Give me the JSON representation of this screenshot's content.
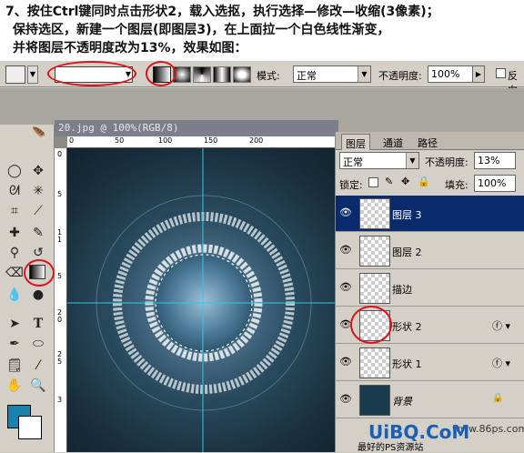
{
  "instructions": [
    "7、按住Ctrl键同时点击形状2，载入选抠，执行选择—修改—收缩(3像素)；",
    "保持选区，新建一个图层(即图层3)，在上面拉一个白色线性渐变，",
    "并将图层不透明度改为13%，效果如图："
  ],
  "options_bar": {
    "mode_label": "模式:",
    "mode_value": "正常",
    "opacity_label": "不透明度:",
    "opacity_value": "100%",
    "reverse_label": "反向"
  },
  "document": {
    "title": "20.jpg @ 100%(RGB/8)",
    "ruler_top": [
      "0",
      "50",
      "100",
      "150",
      "200"
    ],
    "ruler_left": [
      "0",
      "5",
      "1",
      "1",
      "5",
      "2",
      "0",
      "2",
      "5",
      "3"
    ]
  },
  "layers_panel": {
    "tabs": [
      "图层",
      "通道",
      "路径"
    ],
    "blend_mode": "正常",
    "opacity_label": "不透明度:",
    "opacity_value": "13%",
    "lock_label": "锁定:",
    "fill_label": "填充:",
    "fill_value": "100%",
    "layers": [
      {
        "name": "图层 3",
        "selected": true
      },
      {
        "name": "图层 2",
        "selected": false
      },
      {
        "name": "描边",
        "selected": false
      },
      {
        "name": "形状 2",
        "selected": false
      },
      {
        "name": "形状 1",
        "selected": false
      },
      {
        "name": "背景",
        "selected": false
      }
    ]
  },
  "watermark": {
    "site": "www.86ps.com",
    "logo": "UiBQ.CoM",
    "footer": "最好的PS资源站"
  },
  "colors": {
    "foreground": "#1883ad",
    "background": "#ffffff",
    "annotation": "#d8141b",
    "selected_layer": "#0a2a6e"
  }
}
